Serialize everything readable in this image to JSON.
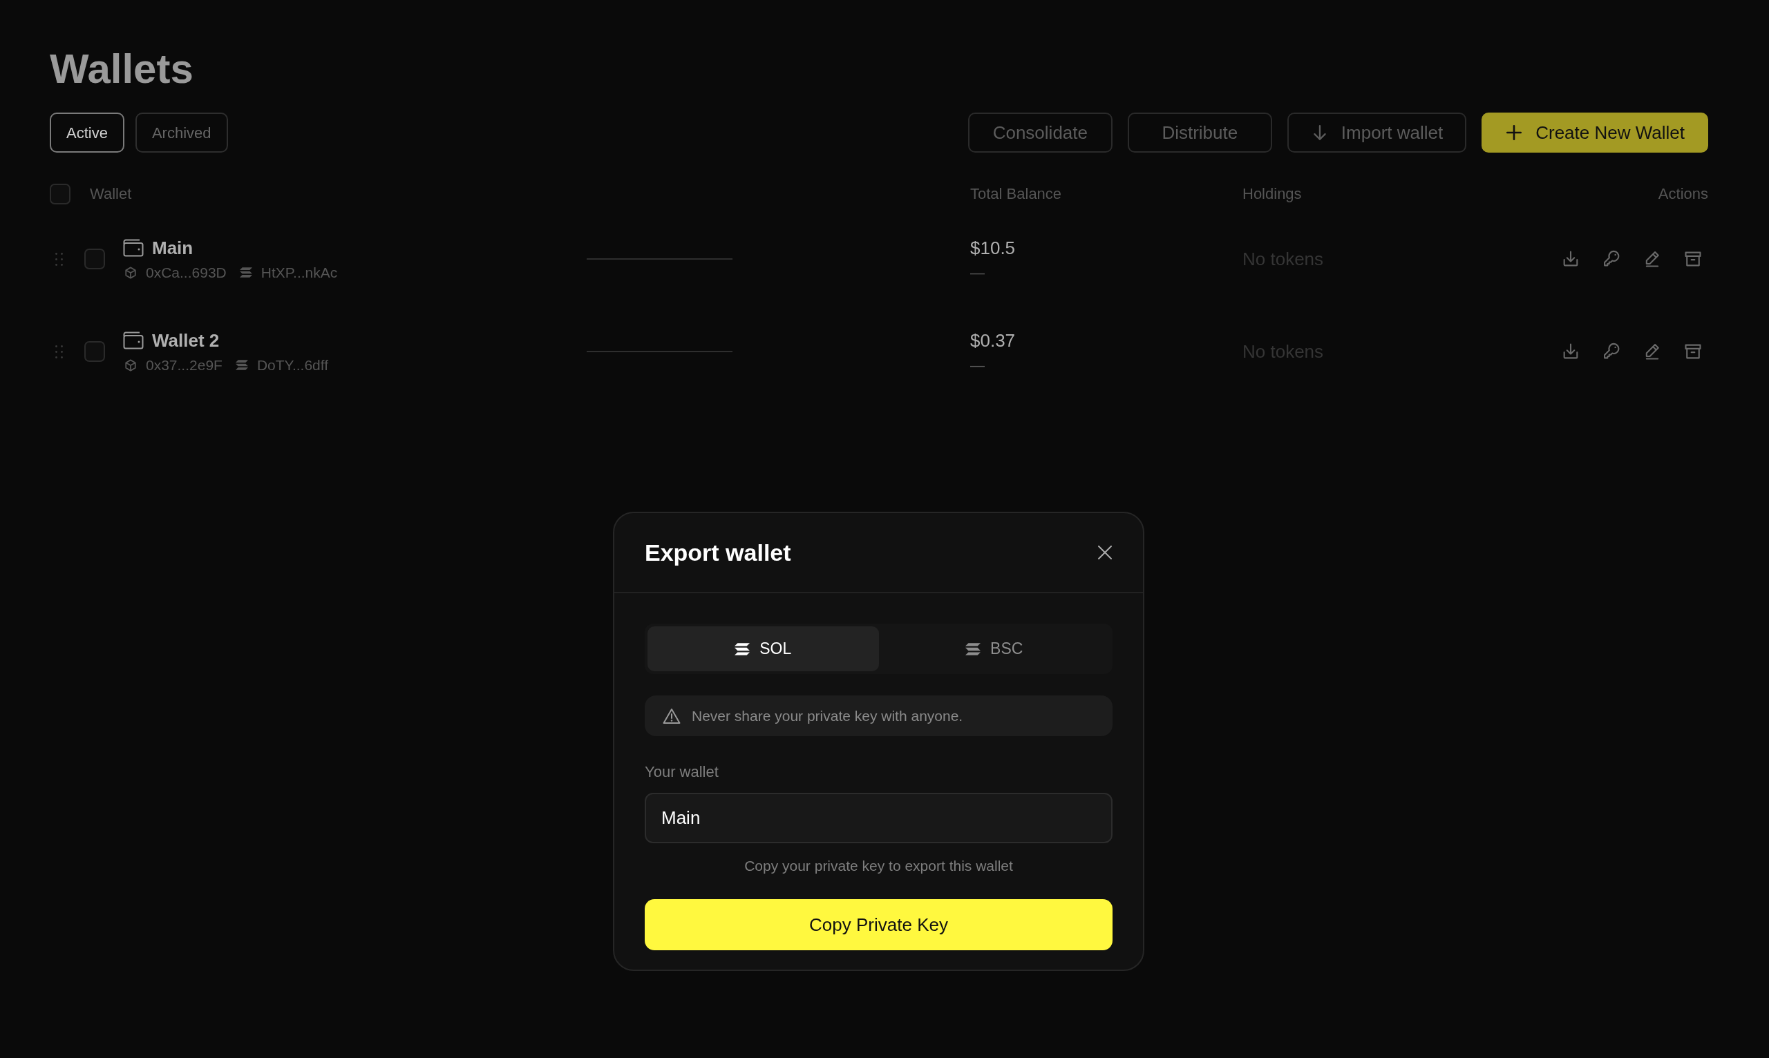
{
  "page": {
    "title": "Wallets"
  },
  "filter_tabs": [
    {
      "label": "Active",
      "selected": true
    },
    {
      "label": "Archived",
      "selected": false
    }
  ],
  "toolbar_buttons": [
    {
      "label": "Consolidate",
      "kind": "outline"
    },
    {
      "label": "Distribute",
      "kind": "outline"
    },
    {
      "label": "Import wallet",
      "kind": "import"
    },
    {
      "label": "Create New Wallet",
      "kind": "create"
    }
  ],
  "table": {
    "select_all": {
      "checked": false
    },
    "columns": [
      "Wallet",
      "Total Balance",
      "Holdings",
      "Actions"
    ],
    "rows": [
      {
        "checked": false,
        "name": "Main",
        "evm_address": "0xCa...693D",
        "sol_address": "HtXP...nkAc",
        "balance": "$10.5",
        "change": "—",
        "holdings": "No tokens"
      },
      {
        "checked": false,
        "name": "Wallet 2",
        "evm_address": "0x37...2e9F",
        "sol_address": "DoTY...6dff",
        "balance": "$0.37",
        "change": "—",
        "holdings": "No tokens"
      }
    ]
  },
  "modal": {
    "title": "Export wallet",
    "chain_tabs": [
      {
        "label": "SOL",
        "selected": true
      },
      {
        "label": "BSC",
        "selected": false
      }
    ],
    "warning": "Never share your private key with anyone.",
    "wallet_field": {
      "label": "Your wallet",
      "value": "Main"
    },
    "hint": "Copy your private key to export this wallet",
    "button": "Copy Private Key"
  }
}
